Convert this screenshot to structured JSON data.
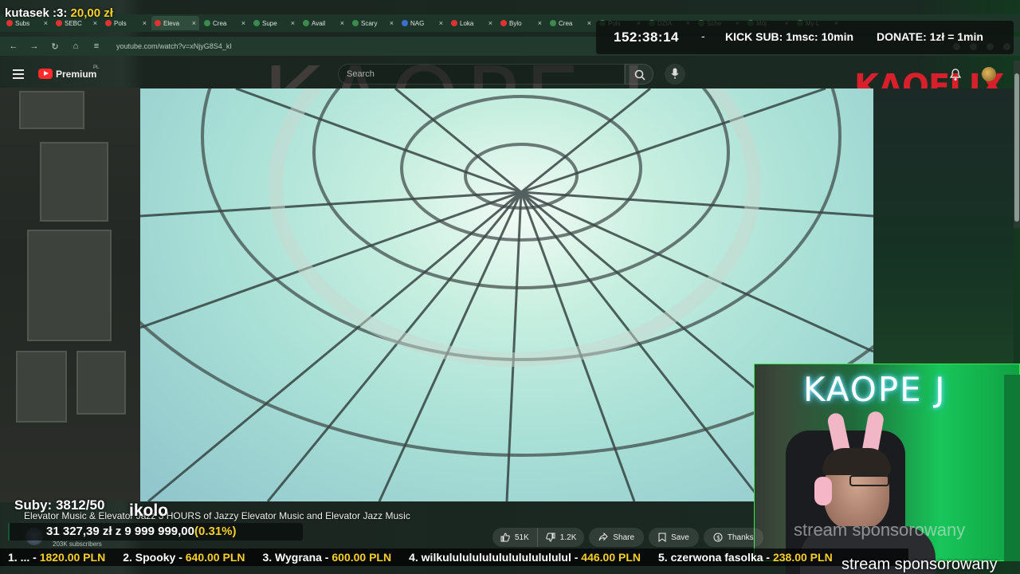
{
  "overlay": {
    "donor_name": "kutasek :3:",
    "donor_amount": "20,00 zł",
    "timer": "152:38:14",
    "timer_sep": "-",
    "kick_sub": "KICK SUB: 1msc: 10min",
    "donate": "DONATE: 1zł = 1min",
    "subs_counter": "Suby: 3812/50",
    "ikolo": "ikolo",
    "goal_text": "31 327,39 zł z 9 999 999,00",
    "goal_pct": "(0.31%)",
    "goal_progress": 0.0031,
    "sponsor_faded": "stream sponsorowany",
    "sponsor": "stream sponsorowany",
    "cam_neon": "KAOPE J",
    "watermark": "KAOPE J",
    "leaderboard": [
      {
        "name": "1. ... - ",
        "amount": "1820.00 PLN"
      },
      {
        "name": "2. Spooky - ",
        "amount": "640.00 PLN"
      },
      {
        "name": "3. Wygrana - ",
        "amount": "600.00 PLN"
      },
      {
        "name": "4. wilkululululululululululululul - ",
        "amount": "446.00 PLN"
      },
      {
        "name": "5. czerwona fasolka - ",
        "amount": "238.00 PLN"
      }
    ]
  },
  "browser": {
    "tabs": [
      {
        "label": "Subs",
        "fav": "youtube"
      },
      {
        "label": "SEBC",
        "fav": "youtube"
      },
      {
        "label": "Pols",
        "fav": "youtube"
      },
      {
        "label": "Eleva",
        "fav": "youtube",
        "active": true
      },
      {
        "label": "Crea",
        "fav": "generic"
      },
      {
        "label": "Supe",
        "fav": "generic"
      },
      {
        "label": "Avail",
        "fav": "generic"
      },
      {
        "label": "Scary",
        "fav": "generic"
      },
      {
        "label": "NAG",
        "fav": "doc"
      },
      {
        "label": "Loka",
        "fav": "youtube"
      },
      {
        "label": "Bylo",
        "fav": "youtube"
      },
      {
        "label": "Crea",
        "fav": "generic"
      },
      {
        "label": "Pols",
        "fav": "generic"
      },
      {
        "label": "DZIA",
        "fav": "generic"
      },
      {
        "label": "Sche",
        "fav": "generic"
      },
      {
        "label": "Mój",
        "fav": "generic"
      },
      {
        "label": "My L",
        "fav": "generic"
      }
    ],
    "url": "youtube.com/watch?v=xNjyG8S4_kI"
  },
  "youtube": {
    "premium_label": "Premium",
    "region": "PL",
    "search_placeholder": "Search",
    "brand": "KAOFLIX",
    "video_title": "Elevator Music & Elevator Jazz 3 HOURS of Jazzy Elevator Music and Elevator Jazz Music",
    "subscribers": "203K subscribers",
    "likes": "51K",
    "dislikes": "1.2K",
    "share_label": "Share",
    "save_label": "Save",
    "thanks_label": "Thanks"
  },
  "colors": {
    "accent_yellow": "#f6cf2b",
    "youtube_red": "#ff2b2b",
    "brand_red": "#d8202d",
    "greenscreen": "#18c65a"
  }
}
